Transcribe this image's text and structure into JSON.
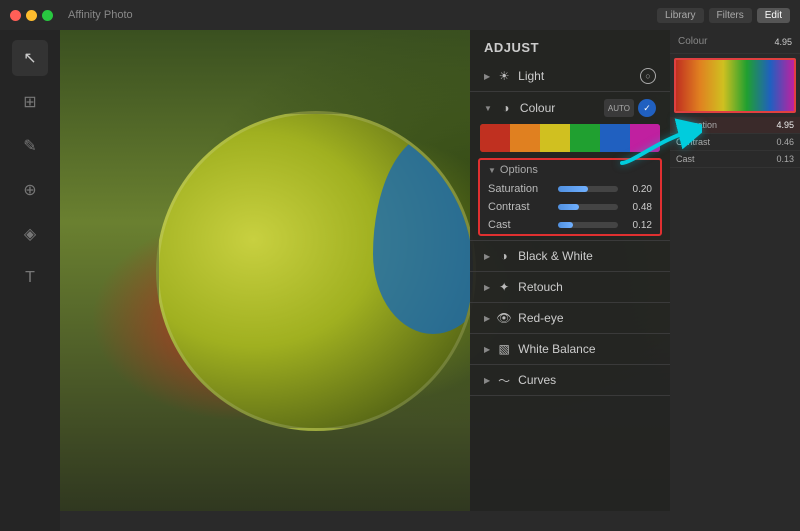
{
  "app": {
    "title": "Affinity Photo",
    "top_buttons": [
      "Library",
      "Filters",
      "Edit"
    ]
  },
  "top_bar": {
    "active_btn": "Edit"
  },
  "right_panel": {
    "header": "Colour",
    "value_label": "4.95",
    "controls": [
      {
        "label": "Saturation",
        "value": "4.95",
        "fill_pct": 75,
        "highlighted": true
      },
      {
        "label": "Contrast",
        "value": "0.46",
        "fill_pct": 50,
        "highlighted": false
      },
      {
        "label": "Cast",
        "value": "0.13",
        "fill_pct": 30,
        "highlighted": false
      }
    ]
  },
  "adjust_panel": {
    "header": "ADJUST",
    "sections": [
      {
        "id": "light",
        "label": "Light",
        "icon": "☀",
        "expanded": false,
        "has_circle_btn": true
      },
      {
        "id": "colour",
        "label": "Colour",
        "icon": "◑",
        "expanded": true,
        "has_auto": true,
        "has_check": true
      }
    ],
    "options": {
      "header": "Options",
      "rows": [
        {
          "label": "Saturation",
          "value": "0.20",
          "fill_pct": 50
        },
        {
          "label": "Contrast",
          "value": "0.48",
          "fill_pct": 35
        },
        {
          "label": "Cast",
          "value": "0.12",
          "fill_pct": 25
        }
      ]
    },
    "extra_sections": [
      {
        "label": "Black & White",
        "icon": "◑"
      },
      {
        "label": "Retouch",
        "icon": "✦"
      },
      {
        "label": "Red-eye",
        "icon": "👁"
      },
      {
        "label": "White Balance",
        "icon": "▧"
      },
      {
        "label": "Curves",
        "icon": "~"
      }
    ]
  }
}
